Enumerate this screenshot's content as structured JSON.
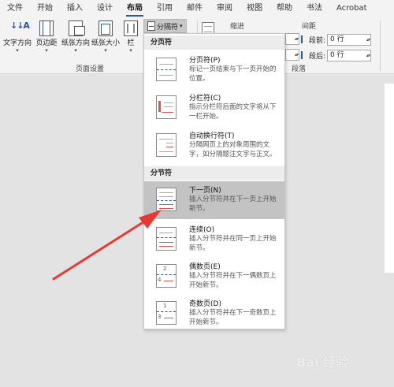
{
  "tabs": [
    {
      "label": "文件"
    },
    {
      "label": "开始"
    },
    {
      "label": "插入"
    },
    {
      "label": "设计"
    },
    {
      "label": "布局",
      "active": true
    },
    {
      "label": "引用"
    },
    {
      "label": "邮件"
    },
    {
      "label": "审阅"
    },
    {
      "label": "视图"
    },
    {
      "label": "帮助"
    },
    {
      "label": "书法"
    },
    {
      "label": "Acrobat"
    }
  ],
  "ribbon": {
    "text_direction": "文字方向",
    "margins": "页边距",
    "orientation": "纸张方向",
    "size": "纸张大小",
    "columns": "栏",
    "page_setup_group": "页面设置",
    "breaks_label": "分隔符",
    "indent_label": "缩进",
    "spacing_label": "间距",
    "spacing_before_label": "段前:",
    "spacing_before_value": "0 行",
    "spacing_after_label": "段后:",
    "spacing_after_value": "0 行",
    "paragraph_group": "段落"
  },
  "menu": {
    "page_breaks_header": "分页符",
    "section_breaks_header": "分节符",
    "items": [
      {
        "title": "分页符(P)",
        "desc": "标记一页结束与下一页开始的位置。",
        "icon": "page-break-icon"
      },
      {
        "title": "分栏符(C)",
        "desc": "指示分栏符后面的文字将从下一栏开始。",
        "icon": "column-break-icon"
      },
      {
        "title": "自动换行符(T)",
        "desc": "分隔网页上的对象周围的文字，如分隔题注文字与正文。",
        "icon": "text-wrapping-break-icon"
      },
      {
        "title": "下一页(N)",
        "desc": "插入分节符并在下一页上开始新节。",
        "icon": "next-page-section-icon",
        "highlighted": true
      },
      {
        "title": "连续(O)",
        "desc": "插入分节符并在同一页上开始新节。",
        "icon": "continuous-section-icon"
      },
      {
        "title": "偶数页(E)",
        "desc": "插入分节符并在下一偶数页上开始新节。",
        "icon": "even-page-section-icon"
      },
      {
        "title": "奇数页(D)",
        "desc": "插入分节符并在下一奇数页上开始新节。",
        "icon": "odd-page-section-icon"
      }
    ]
  },
  "watermark": "Bai 经验",
  "colors": {
    "accent": "#2b579a",
    "arrow": "#e53935",
    "highlight": "#c3c3c3"
  }
}
